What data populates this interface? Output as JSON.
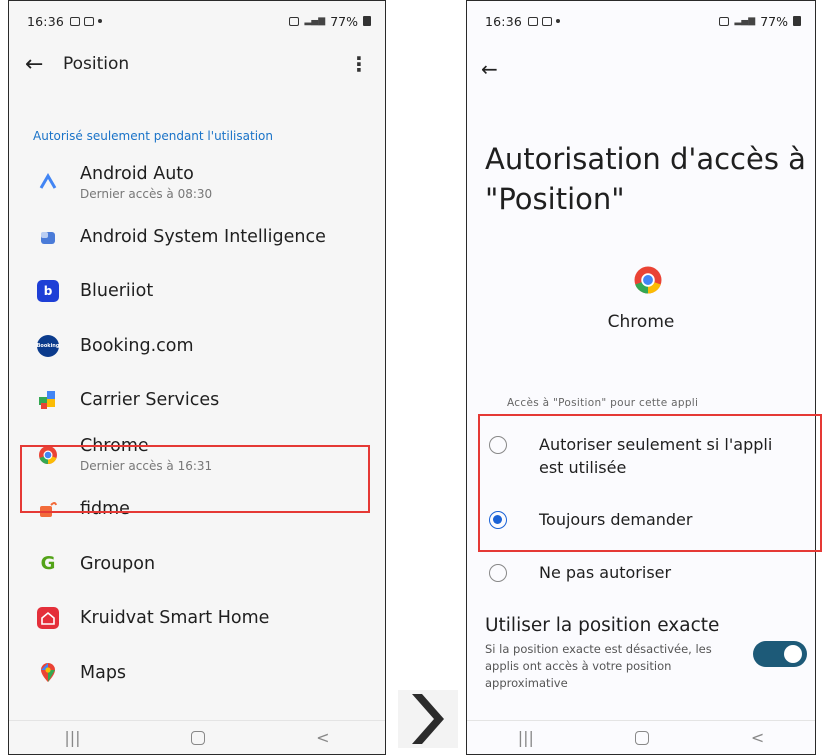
{
  "left_screen": {
    "status_bar": {
      "time": "16:36",
      "battery": "77%"
    },
    "toolbar": {
      "title": "Position",
      "back_icon": "arrow-left-icon",
      "more_icon": "more-vert-icon"
    },
    "section_header": "Autorisé seulement pendant l'utilisation",
    "apps": [
      {
        "name": "Android Auto",
        "subtitle": "Dernier accès à 08:30"
      },
      {
        "name": "Android System Intelligence",
        "subtitle": ""
      },
      {
        "name": "Blueriiot",
        "subtitle": ""
      },
      {
        "name": "Booking.com",
        "subtitle": ""
      },
      {
        "name": "Carrier Services",
        "subtitle": ""
      },
      {
        "name": "Chrome",
        "subtitle": "Dernier accès à 16:31"
      },
      {
        "name": "fidme",
        "subtitle": ""
      },
      {
        "name": "Groupon",
        "subtitle": ""
      },
      {
        "name": "Kruidvat Smart Home",
        "subtitle": ""
      },
      {
        "name": "Maps",
        "subtitle": ""
      }
    ],
    "nav": {
      "recents": "|||",
      "home": "",
      "back": "<"
    }
  },
  "right_screen": {
    "status_bar": {
      "time": "16:36",
      "battery": "77%"
    },
    "title": "Autorisation d'accès à \"Position\"",
    "app_name": "Chrome",
    "section_label": "Accès à \"Position\" pour cette appli",
    "options": [
      {
        "label": "Autoriser seulement si l'appli est utilisée",
        "selected": false
      },
      {
        "label": "Toujours demander",
        "selected": true
      },
      {
        "label": "Ne pas autoriser",
        "selected": false
      }
    ],
    "precise": {
      "title": "Utiliser la position exacte",
      "description": "Si la position exacte est désactivée, les applis ont accès à votre position approximative",
      "enabled": true
    },
    "nav": {
      "recents": "|||",
      "home": "",
      "back": "<"
    }
  },
  "colors": {
    "accent_blue": "#1a62d6",
    "highlight_red": "#e53935",
    "toggle_on": "#1d5a78",
    "section_blue": "#1a73c8"
  }
}
